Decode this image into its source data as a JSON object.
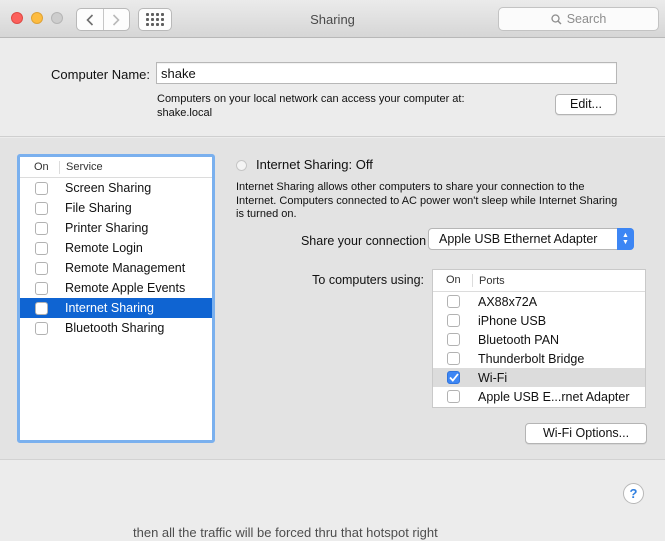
{
  "window": {
    "title": "Sharing",
    "search_placeholder": "Search"
  },
  "computer": {
    "name_label": "Computer Name:",
    "name_value": "shake",
    "info_line1": "Computers on your local network can access your computer at:",
    "info_line2": "shake.local",
    "edit_label": "Edit..."
  },
  "services": {
    "col_on": "On",
    "col_service": "Service",
    "items": [
      {
        "label": "Screen Sharing",
        "checked": false
      },
      {
        "label": "File Sharing",
        "checked": false
      },
      {
        "label": "Printer Sharing",
        "checked": false
      },
      {
        "label": "Remote Login",
        "checked": false
      },
      {
        "label": "Remote Management",
        "checked": false
      },
      {
        "label": "Remote Apple Events",
        "checked": false
      },
      {
        "label": "Internet Sharing",
        "checked": false,
        "selected": true
      },
      {
        "label": "Bluetooth Sharing",
        "checked": false
      }
    ]
  },
  "internet_sharing": {
    "status": "Internet Sharing: Off",
    "description": "Internet Sharing allows other computers to share your connection to the Internet. Computers connected to AC power won't sleep while Internet Sharing is turned on.",
    "share_from_label": "Share your connection from:",
    "share_from_value": "Apple USB Ethernet Adapter",
    "to_computers_label": "To computers using:",
    "ports_col_on": "On",
    "ports_col_ports": "Ports",
    "ports": [
      {
        "label": "AX88x72A",
        "checked": false
      },
      {
        "label": "iPhone USB",
        "checked": false
      },
      {
        "label": "Bluetooth PAN",
        "checked": false
      },
      {
        "label": "Thunderbolt Bridge",
        "checked": false
      },
      {
        "label": "Wi-Fi",
        "checked": true
      },
      {
        "label": "Apple USB E...rnet Adapter",
        "checked": false
      }
    ],
    "wifi_options_label": "Wi-Fi Options..."
  },
  "help_label": "?",
  "background_text": "then all the traffic will be forced thru that hotspot right",
  "colors": {
    "selection": "#0f64d2",
    "focus_ring": "#7ab0ee",
    "accent": "#3d86f4"
  }
}
